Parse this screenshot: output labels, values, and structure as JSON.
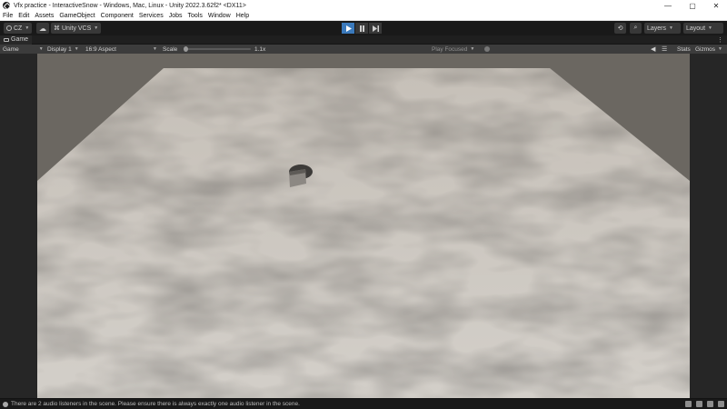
{
  "window": {
    "title": "Vfx practice - InteractiveSnow - Windows, Mac, Linux - Unity 2022.3.62f2* <DX11>",
    "controls": [
      "—",
      "▢",
      "✕"
    ]
  },
  "menu": [
    "File",
    "Edit",
    "Assets",
    "GameObject",
    "Component",
    "Services",
    "Jobs",
    "Tools",
    "Window",
    "Help"
  ],
  "toolbar": {
    "account": "CZ",
    "vcs": "Unity VCS",
    "layers": "Layers",
    "layout": "Layout"
  },
  "panel": {
    "tab": "Game"
  },
  "gamebar": {
    "mode": "Game",
    "display": "Display 1",
    "aspect": "16:9 Aspect",
    "scale_label": "Scale",
    "scale_value": "1.1x",
    "play_focused": "Play Focused",
    "stats": "Stats",
    "gizmos": "Gizmos"
  },
  "status": {
    "message": "There are 2 audio listeners in the scene. Please ensure there is always exactly one audio listener in the scene."
  },
  "colors": {
    "play_active": "#3a79bb",
    "snow": "#cfcac3",
    "sky": "#6b6761"
  }
}
